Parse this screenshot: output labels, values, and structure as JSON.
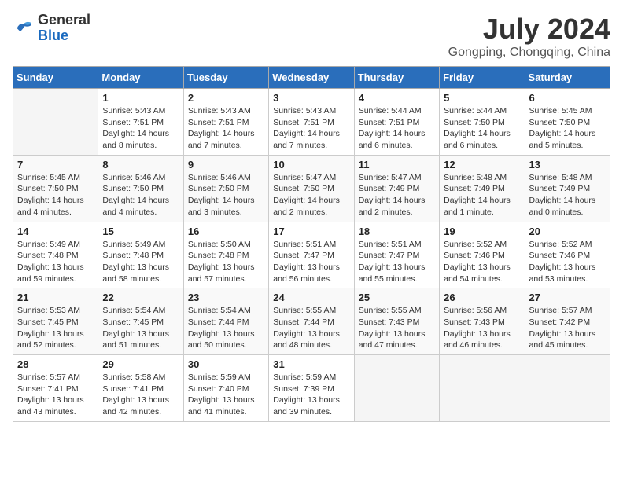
{
  "header": {
    "logo_general": "General",
    "logo_blue": "Blue",
    "month_year": "July 2024",
    "location": "Gongping, Chongqing, China"
  },
  "columns": [
    "Sunday",
    "Monday",
    "Tuesday",
    "Wednesday",
    "Thursday",
    "Friday",
    "Saturday"
  ],
  "weeks": [
    [
      {
        "day": "",
        "info": ""
      },
      {
        "day": "1",
        "info": "Sunrise: 5:43 AM\nSunset: 7:51 PM\nDaylight: 14 hours\nand 8 minutes."
      },
      {
        "day": "2",
        "info": "Sunrise: 5:43 AM\nSunset: 7:51 PM\nDaylight: 14 hours\nand 7 minutes."
      },
      {
        "day": "3",
        "info": "Sunrise: 5:43 AM\nSunset: 7:51 PM\nDaylight: 14 hours\nand 7 minutes."
      },
      {
        "day": "4",
        "info": "Sunrise: 5:44 AM\nSunset: 7:51 PM\nDaylight: 14 hours\nand 6 minutes."
      },
      {
        "day": "5",
        "info": "Sunrise: 5:44 AM\nSunset: 7:50 PM\nDaylight: 14 hours\nand 6 minutes."
      },
      {
        "day": "6",
        "info": "Sunrise: 5:45 AM\nSunset: 7:50 PM\nDaylight: 14 hours\nand 5 minutes."
      }
    ],
    [
      {
        "day": "7",
        "info": "Sunrise: 5:45 AM\nSunset: 7:50 PM\nDaylight: 14 hours\nand 4 minutes."
      },
      {
        "day": "8",
        "info": "Sunrise: 5:46 AM\nSunset: 7:50 PM\nDaylight: 14 hours\nand 4 minutes."
      },
      {
        "day": "9",
        "info": "Sunrise: 5:46 AM\nSunset: 7:50 PM\nDaylight: 14 hours\nand 3 minutes."
      },
      {
        "day": "10",
        "info": "Sunrise: 5:47 AM\nSunset: 7:50 PM\nDaylight: 14 hours\nand 2 minutes."
      },
      {
        "day": "11",
        "info": "Sunrise: 5:47 AM\nSunset: 7:49 PM\nDaylight: 14 hours\nand 2 minutes."
      },
      {
        "day": "12",
        "info": "Sunrise: 5:48 AM\nSunset: 7:49 PM\nDaylight: 14 hours\nand 1 minute."
      },
      {
        "day": "13",
        "info": "Sunrise: 5:48 AM\nSunset: 7:49 PM\nDaylight: 14 hours\nand 0 minutes."
      }
    ],
    [
      {
        "day": "14",
        "info": "Sunrise: 5:49 AM\nSunset: 7:48 PM\nDaylight: 13 hours\nand 59 minutes."
      },
      {
        "day": "15",
        "info": "Sunrise: 5:49 AM\nSunset: 7:48 PM\nDaylight: 13 hours\nand 58 minutes."
      },
      {
        "day": "16",
        "info": "Sunrise: 5:50 AM\nSunset: 7:48 PM\nDaylight: 13 hours\nand 57 minutes."
      },
      {
        "day": "17",
        "info": "Sunrise: 5:51 AM\nSunset: 7:47 PM\nDaylight: 13 hours\nand 56 minutes."
      },
      {
        "day": "18",
        "info": "Sunrise: 5:51 AM\nSunset: 7:47 PM\nDaylight: 13 hours\nand 55 minutes."
      },
      {
        "day": "19",
        "info": "Sunrise: 5:52 AM\nSunset: 7:46 PM\nDaylight: 13 hours\nand 54 minutes."
      },
      {
        "day": "20",
        "info": "Sunrise: 5:52 AM\nSunset: 7:46 PM\nDaylight: 13 hours\nand 53 minutes."
      }
    ],
    [
      {
        "day": "21",
        "info": "Sunrise: 5:53 AM\nSunset: 7:45 PM\nDaylight: 13 hours\nand 52 minutes."
      },
      {
        "day": "22",
        "info": "Sunrise: 5:54 AM\nSunset: 7:45 PM\nDaylight: 13 hours\nand 51 minutes."
      },
      {
        "day": "23",
        "info": "Sunrise: 5:54 AM\nSunset: 7:44 PM\nDaylight: 13 hours\nand 50 minutes."
      },
      {
        "day": "24",
        "info": "Sunrise: 5:55 AM\nSunset: 7:44 PM\nDaylight: 13 hours\nand 48 minutes."
      },
      {
        "day": "25",
        "info": "Sunrise: 5:55 AM\nSunset: 7:43 PM\nDaylight: 13 hours\nand 47 minutes."
      },
      {
        "day": "26",
        "info": "Sunrise: 5:56 AM\nSunset: 7:43 PM\nDaylight: 13 hours\nand 46 minutes."
      },
      {
        "day": "27",
        "info": "Sunrise: 5:57 AM\nSunset: 7:42 PM\nDaylight: 13 hours\nand 45 minutes."
      }
    ],
    [
      {
        "day": "28",
        "info": "Sunrise: 5:57 AM\nSunset: 7:41 PM\nDaylight: 13 hours\nand 43 minutes."
      },
      {
        "day": "29",
        "info": "Sunrise: 5:58 AM\nSunset: 7:41 PM\nDaylight: 13 hours\nand 42 minutes."
      },
      {
        "day": "30",
        "info": "Sunrise: 5:59 AM\nSunset: 7:40 PM\nDaylight: 13 hours\nand 41 minutes."
      },
      {
        "day": "31",
        "info": "Sunrise: 5:59 AM\nSunset: 7:39 PM\nDaylight: 13 hours\nand 39 minutes."
      },
      {
        "day": "",
        "info": ""
      },
      {
        "day": "",
        "info": ""
      },
      {
        "day": "",
        "info": ""
      }
    ]
  ]
}
